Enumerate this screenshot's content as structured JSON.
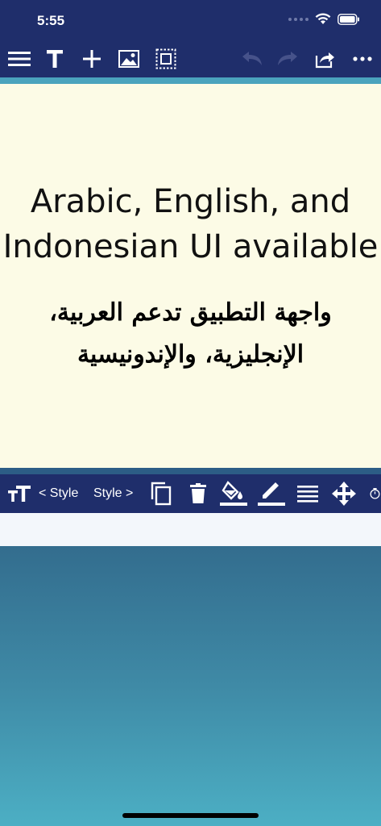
{
  "status_bar": {
    "time": "5:55"
  },
  "top_toolbar": {
    "icons": [
      "menu-icon",
      "text-icon",
      "add-icon",
      "image-icon",
      "select-area-icon",
      "undo-icon",
      "redo-icon",
      "share-icon",
      "more-icon"
    ]
  },
  "canvas": {
    "background": "#fcfbe6",
    "english_line_1": "Arabic, English, and",
    "english_line_2": "Indonesian UI available",
    "arabic_line_1": "واجهة التطبيق تدعم العربية،",
    "arabic_line_2": "الإنجليزية، والإندونيسية"
  },
  "style_toolbar": {
    "prev_style_label": "< Style",
    "next_style_label": "Style >",
    "icons": [
      "text-size-icon",
      "copy-icon",
      "delete-icon",
      "fill-color-icon",
      "pen-color-icon",
      "line-weight-icon",
      "move-icon",
      "rotate-icon"
    ]
  },
  "colors": {
    "toolbar": "#1f2e6b",
    "accent_strip": "#4aa3bd",
    "gradient_top": "#336d8e",
    "gradient_bottom": "#4cafc4"
  }
}
